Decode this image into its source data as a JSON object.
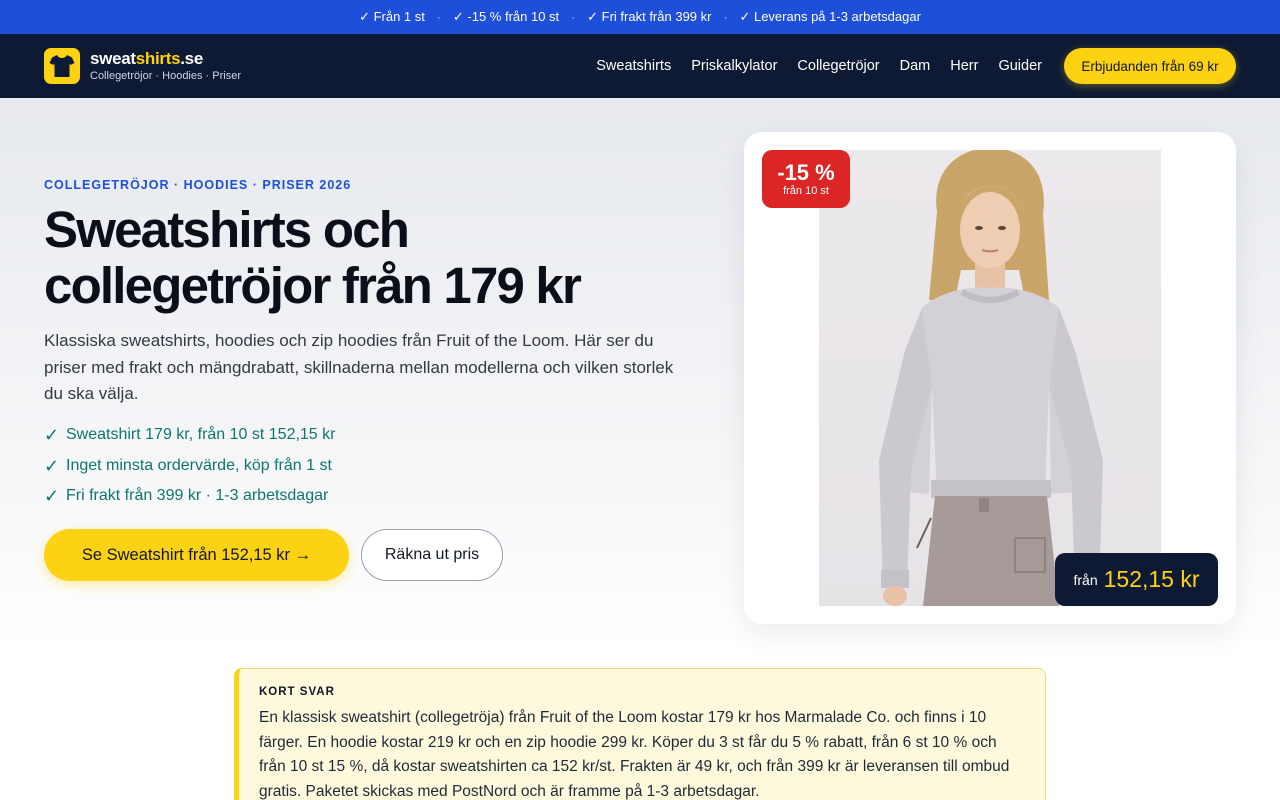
{
  "topbar": {
    "items": [
      "✓ Från 1 st",
      "✓ -15 % från 10 st",
      "✓ Fri frakt från 399 kr",
      "✓ Leverans på 1-3 arbetsdagar"
    ],
    "separator": "·"
  },
  "header": {
    "logo": {
      "name_part1": "sweat",
      "name_part2": "shirts",
      "name_part3": ".se",
      "tagline": "Collegetröjor · Hoodies · Priser",
      "icon": "tshirt-icon"
    },
    "nav": [
      "Sweatshirts",
      "Priskalkylator",
      "Collegetröjor",
      "Dam",
      "Herr",
      "Guider"
    ],
    "cta_label": "Erbjudanden från 69 kr"
  },
  "hero": {
    "eyebrow": "COLLEGETRÖJOR · HOODIES · PRISER 2026",
    "title": "Sweatshirts och collegetröjor från 179 kr",
    "lead": "Klassiska sweatshirts, hoodies och zip hoodies från Fruit of the Loom. Här ser du priser med frakt och mängdrabatt, skillnaderna mellan modellerna och vilken storlek du ska välja.",
    "checks": [
      "Sweatshirt 179 kr, från 10 st 152,15 kr",
      "Inget minsta ordervärde, köp från 1 st",
      "Fri frakt från 399 kr · 1-3 arbetsdagar"
    ],
    "check_icon": "✓",
    "primary_button": "Se Sweatshirt från 152,15 kr →",
    "secondary_button": "Räkna ut pris"
  },
  "product_card": {
    "badge_big": "-15 %",
    "badge_small": "från 10 st",
    "price_prefix": "från",
    "price": "152,15 kr"
  },
  "short_answer": {
    "label": "KORT SVAR",
    "text": "En klassisk sweatshirt (collegetröja) från Fruit of the Loom kostar 179 kr hos Marmalade Co. och finns i 10 färger. En hoodie kostar 219 kr och en zip hoodie 299 kr. Köper du 3 st får du 5 % rabatt, från 6 st 10 % och från 10 st 15 %, då kostar sweatshirten ca 152 kr/st. Frakten är 49 kr, och från 399 kr är leveransen till ombud gratis. Paketet skickas med PostNord och är framme på 1-3 arbetsdagar."
  },
  "colors": {
    "topbar": "#1d4fd8",
    "header": "#0e1a33",
    "accent_yellow": "#fcd213",
    "check_green": "#0f766e",
    "badge_red": "#dc2626"
  }
}
